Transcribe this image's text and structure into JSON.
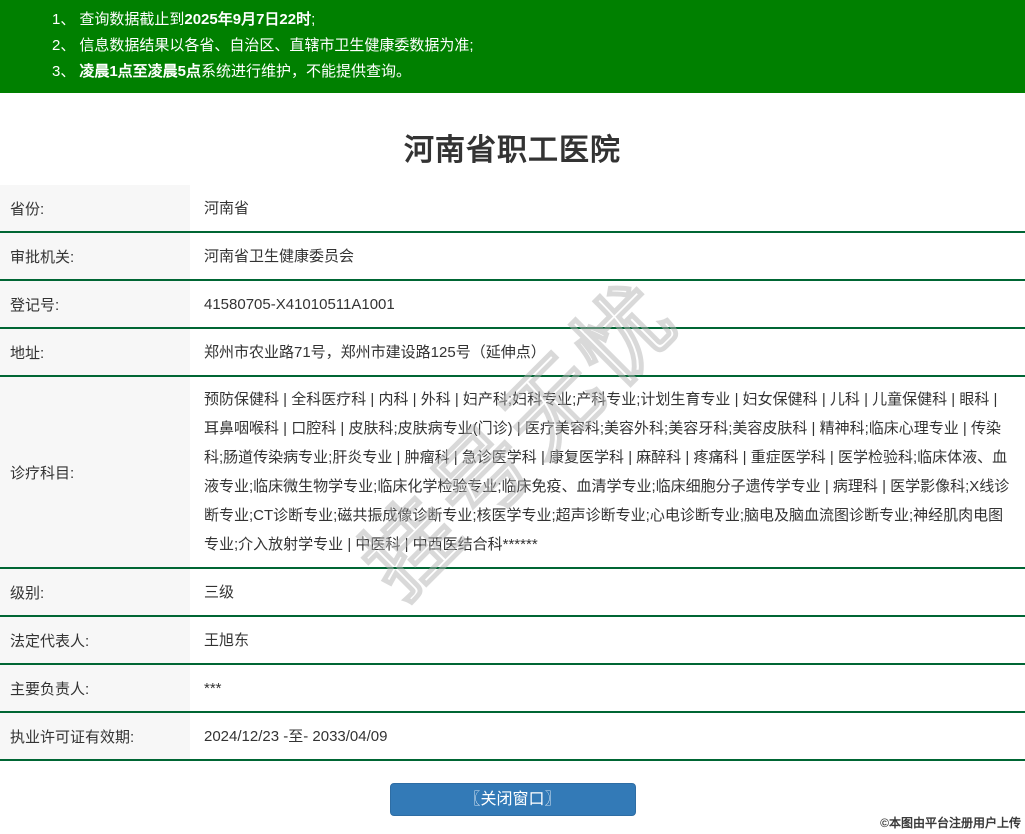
{
  "page": {
    "title": "河南省职工医院"
  },
  "notice_banner": {
    "bg_color": "#008000",
    "lines": [
      {
        "num": "1、",
        "pre": "查询数据截止到",
        "bold": "2025年9月7日22时",
        "post": ";"
      },
      {
        "num": "2、",
        "pre": "信息数据结果以各省、自治区、直辖市卫生健康委数据为准;",
        "bold": "",
        "post": ""
      },
      {
        "num": "3、",
        "pre": "",
        "bold": "凌晨1点至凌晨5点",
        "post": "系统进行维护，不能提供查询。"
      }
    ]
  },
  "table": {
    "rows": [
      {
        "label": "省份:",
        "value": "河南省"
      },
      {
        "label": "审批机关:",
        "value": "河南省卫生健康委员会"
      },
      {
        "label": "登记号:",
        "value": "41580705-X41010511A1001"
      },
      {
        "label": "地址:",
        "value": "郑州市农业路71号，郑州市建设路125号（延伸点）"
      },
      {
        "label": "诊疗科目:",
        "value": "预防保健科 | 全科医疗科 | 内科 | 外科 | 妇产科;妇科专业;产科专业;计划生育专业 | 妇女保健科 | 儿科 | 儿童保健科 | 眼科 | 耳鼻咽喉科 | 口腔科 | 皮肤科;皮肤病专业(门诊) | 医疗美容科;美容外科;美容牙科;美容皮肤科 | 精神科;临床心理专业 | 传染科;肠道传染病专业;肝炎专业 | 肿瘤科 | 急诊医学科 | 康复医学科 | 麻醉科 | 疼痛科 | 重症医学科 | 医学检验科;临床体液、血液专业;临床微生物学专业;临床化学检验专业;临床免疫、血清学专业;临床细胞分子遗传学专业 | 病理科 | 医学影像科;X线诊断专业;CT诊断专业;磁共振成像诊断专业;核医学专业;超声诊断专业;心电诊断专业;脑电及脑血流图诊断专业;神经肌肉电图专业;介入放射学专业 | 中医科 | 中西医结合科******"
      },
      {
        "label": "级别:",
        "value": "三级"
      },
      {
        "label": "法定代表人:",
        "value": "王旭东"
      },
      {
        "label": "主要负责人:",
        "value": "***"
      },
      {
        "label": "执业许可证有效期:",
        "value": "2024/12/23 -至- 2033/04/09"
      }
    ]
  },
  "footer": {
    "close_button_label": "〖关闭窗口〗"
  },
  "watermark": {
    "diagonal_text": "挂号无忧",
    "credit_badge": "©本图由平台注册用户上传"
  },
  "colors": {
    "banner_green": "#008000",
    "divider_green": "#006634",
    "label_bg": "#f7f7f7",
    "button_blue": "#337ab7",
    "text": "#333333"
  }
}
